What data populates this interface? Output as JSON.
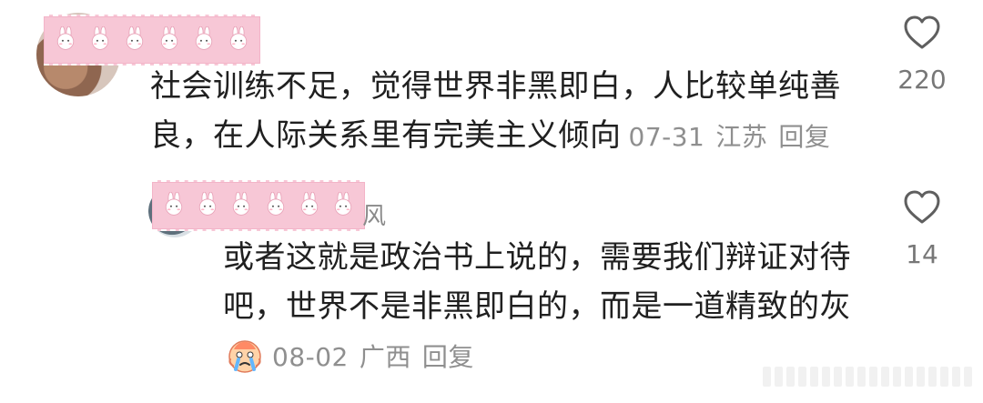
{
  "comments": [
    {
      "username_tail": "",
      "text": "社会训练不足，觉得世界非黑即白，人比较单纯善良，在人际关系里有完美主义倾向",
      "date": "07-31",
      "location": "江苏",
      "reply_label": "回复",
      "likes": "220",
      "icons": {
        "like": "heart-outline-icon"
      }
    }
  ],
  "reply": {
    "username_tail": "风",
    "text": "或者这就是政治书上说的，需要我们辩证对待吧，世界不是非黑即白的，而是一道精致的灰",
    "emoji": "crying-face-emoji",
    "date": "08-02",
    "location": "广西",
    "reply_label": "回复",
    "likes": "14",
    "icons": {
      "like": "heart-outline-icon"
    }
  },
  "colors": {
    "tape": "#f7c7d6",
    "text": "#202020",
    "meta": "#8f8f8f",
    "likes": "#777777"
  }
}
